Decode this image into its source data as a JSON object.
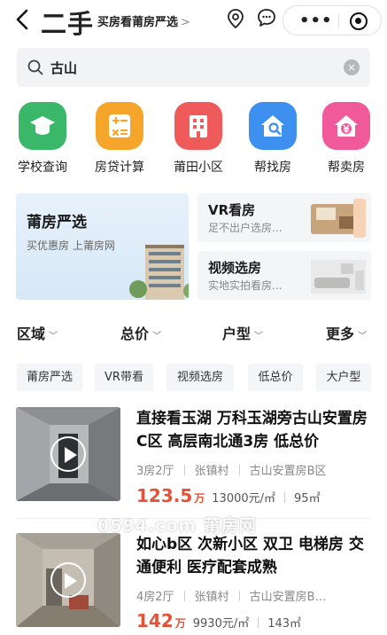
{
  "header": {
    "title": "二手",
    "subtitle": "买房看莆房严选",
    "subtitle_chevron": ">",
    "capsule_dots": "•••"
  },
  "search": {
    "value": "古山",
    "clear_glyph": "×"
  },
  "categories": [
    {
      "label": "学校查询",
      "icon": "graduation-cap-icon",
      "color": "#3bb76a"
    },
    {
      "label": "房贷计算",
      "icon": "calculator-icon",
      "color": "#f4a52a"
    },
    {
      "label": "莆田小区",
      "icon": "building-icon",
      "color": "#ef5b5b"
    },
    {
      "label": "帮找房",
      "icon": "house-search-icon",
      "color": "#3d8ff0"
    },
    {
      "label": "帮卖房",
      "icon": "house-yen-icon",
      "color": "#f05a9a"
    }
  ],
  "banners": {
    "main": {
      "title": "莆房严选",
      "subtitle": "买优惠房 上莆房网"
    },
    "vr": {
      "title": "VR看房",
      "subtitle": "足不出户选房..."
    },
    "video": {
      "title": "视频选房",
      "subtitle": "实地实拍看房..."
    }
  },
  "filters": [
    {
      "label": "区域"
    },
    {
      "label": "总价"
    },
    {
      "label": "户型"
    },
    {
      "label": "更多"
    }
  ],
  "tags": [
    "莆房严选",
    "VR带看",
    "视频选房",
    "低总价",
    "大户型"
  ],
  "listings": [
    {
      "title": "直接看玉湖 万科玉湖旁古山安置房C区 高层南北通3房 低总价",
      "layout": "3房2厅",
      "area_name": "张镇村",
      "community": "古山安置房B区",
      "price": "123.5",
      "price_unit": "万",
      "unit_price": "13000元/㎡",
      "size": "95㎡"
    },
    {
      "title": "如心b区 次新小区 双卫 电梯房 交通便利 医疗配套成熟",
      "layout": "4房2厅",
      "area_name": "张镇村",
      "community": "古山安置房B…",
      "price": "142",
      "price_unit": "万",
      "unit_price": "9930元/㎡",
      "size": "143㎡"
    }
  ],
  "watermark": "0594.com 莆房网"
}
